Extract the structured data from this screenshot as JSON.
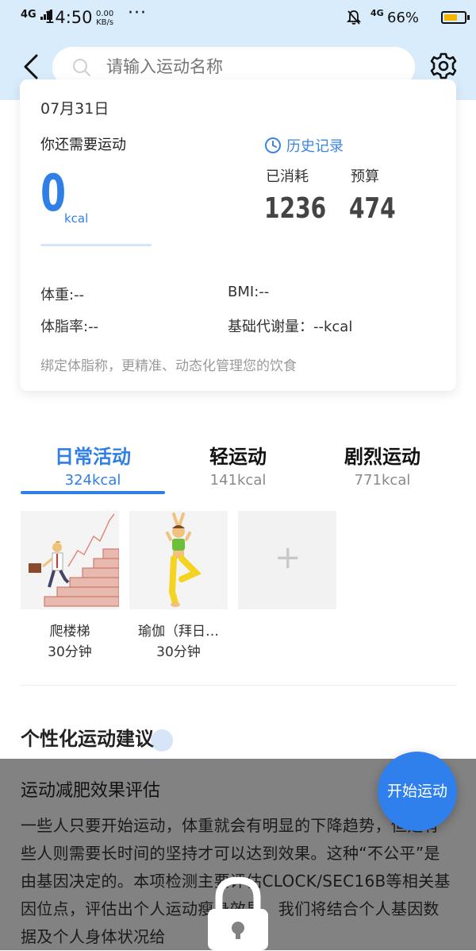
{
  "status_bar": {
    "signal": "4G",
    "time": "14:50",
    "speed_value": "0.00",
    "speed_unit": "KB/s",
    "dots": "···",
    "net": "4G",
    "battery_pct": "66%",
    "battery_level": 0.66,
    "battery_color": "#f5b400"
  },
  "header": {
    "search_placeholder": "请输入运动名称"
  },
  "summary": {
    "date": "07月31日",
    "need_label": "你还需要运动",
    "need_value": "0",
    "need_unit": "kcal",
    "history_label": "历史记录",
    "consumed_label": "已消耗",
    "consumed_value": "1236",
    "budget_label": "预算",
    "budget_value": "474",
    "weight": "体重:--",
    "bmi": "BMI:--",
    "body_fat": "体脂率:--",
    "bmr": "基础代谢量：--kcal",
    "bind_hint": "绑定体脂称，更精准、动态化管理您的饮食"
  },
  "tabs": [
    {
      "name": "日常活动",
      "kcal": "324kcal",
      "active": true
    },
    {
      "name": "轻运动",
      "kcal": "141kcal",
      "active": false
    },
    {
      "name": "剧烈运动",
      "kcal": "771kcal",
      "active": false
    }
  ],
  "activities": [
    {
      "name": "爬楼梯",
      "duration": "30分钟"
    },
    {
      "name": "瑜伽（拜日…",
      "duration": "30分钟"
    }
  ],
  "add_label": "+",
  "advice": {
    "section_title": "个性化运动建议",
    "card_title": "运动减肥效果评估",
    "card_body": "一些人只要开始运动，体重就会有明显的下降趋势，但是有些人则需要长时间的坚持才可以达到效果。这种“不公平”是由基因决定的。本项检测主要评估CLOCK/SEC16B等相关基因位点，评估出个人运动瘦身效果，我们将结合个人基因数据及个人身体状况给"
  },
  "fab_label": "开始运动",
  "colors": {
    "accent": "#2f7fe6",
    "header_bg": "#d9ecfb",
    "overlay": "#828282"
  }
}
